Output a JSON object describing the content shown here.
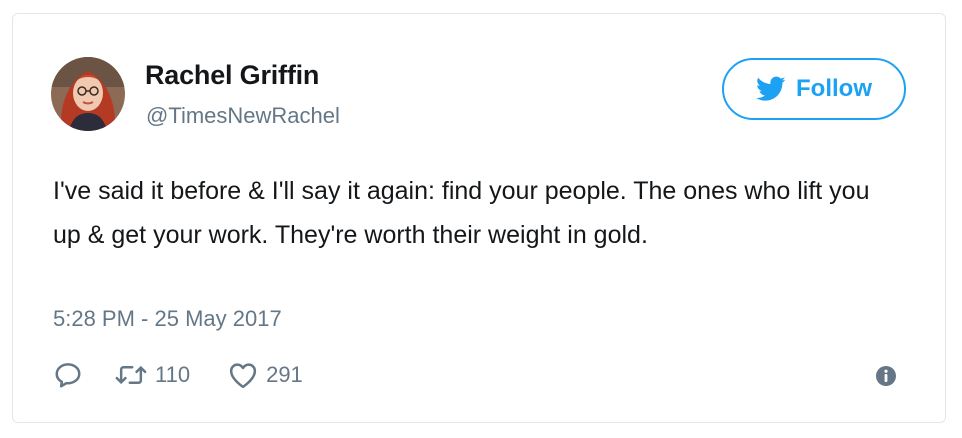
{
  "author": {
    "display_name": "Rachel Griffin",
    "handle": "@TimesNewRachel",
    "avatar_icon": "profile-photo"
  },
  "follow_button": {
    "label": "Follow",
    "icon": "twitter-bird-icon",
    "color": "#1da1f2"
  },
  "tweet": {
    "text": "I've said it before & I'll say it again: find your people. The ones who lift you up & get your work. They're worth their weight in gold.",
    "timestamp": "5:28 PM - 25 May 2017"
  },
  "actions": {
    "reply": {
      "icon": "reply-icon"
    },
    "retweet": {
      "icon": "retweet-icon",
      "count": "110"
    },
    "like": {
      "icon": "heart-icon",
      "count": "291"
    },
    "info": {
      "icon": "info-icon"
    }
  },
  "colors": {
    "text": "#14171a",
    "secondary": "#657786",
    "border": "#e1e8ed",
    "accent": "#1da1f2"
  }
}
